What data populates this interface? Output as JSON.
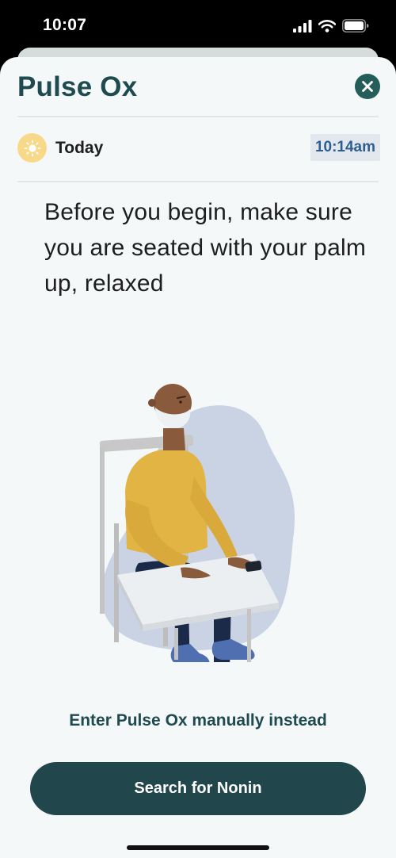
{
  "status_bar": {
    "time": "10:07"
  },
  "header": {
    "title": "Pulse Ox",
    "close_icon": "close-icon"
  },
  "today_row": {
    "icon": "sun-icon",
    "label": "Today",
    "time": "10:14am"
  },
  "instruction": "Before you begin, make sure you are seated with your palm up, relaxed",
  "illustration": {
    "subject": "person-seated-at-table-with-pulse-oximeter"
  },
  "manual_link": "Enter Pulse Ox manually instead",
  "primary_button": "Search for Nonin",
  "colors": {
    "brand_dark": "#21474c",
    "close_button": "#245d59",
    "title_text": "#1f4a4f",
    "sheet_background": "#f4f8f8",
    "sun_badge": "#f8d98a",
    "time_chip_bg": "#e3e8ee",
    "time_chip_text": "#2c5f8f"
  }
}
